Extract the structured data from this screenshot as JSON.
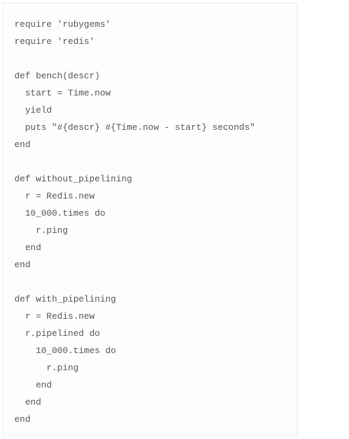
{
  "code": {
    "lines": [
      "require 'rubygems'",
      "require 'redis'",
      "",
      "def bench(descr)",
      "  start = Time.now",
      "  yield",
      "  puts \"#{descr} #{Time.now - start} seconds\"",
      "end",
      "",
      "def without_pipelining",
      "  r = Redis.new",
      "  10_000.times do",
      "    r.ping",
      "  end",
      "end",
      "",
      "def with_pipelining",
      "  r = Redis.new",
      "  r.pipelined do",
      "    10_000.times do",
      "      r.ping",
      "    end",
      "  end",
      "end"
    ]
  }
}
